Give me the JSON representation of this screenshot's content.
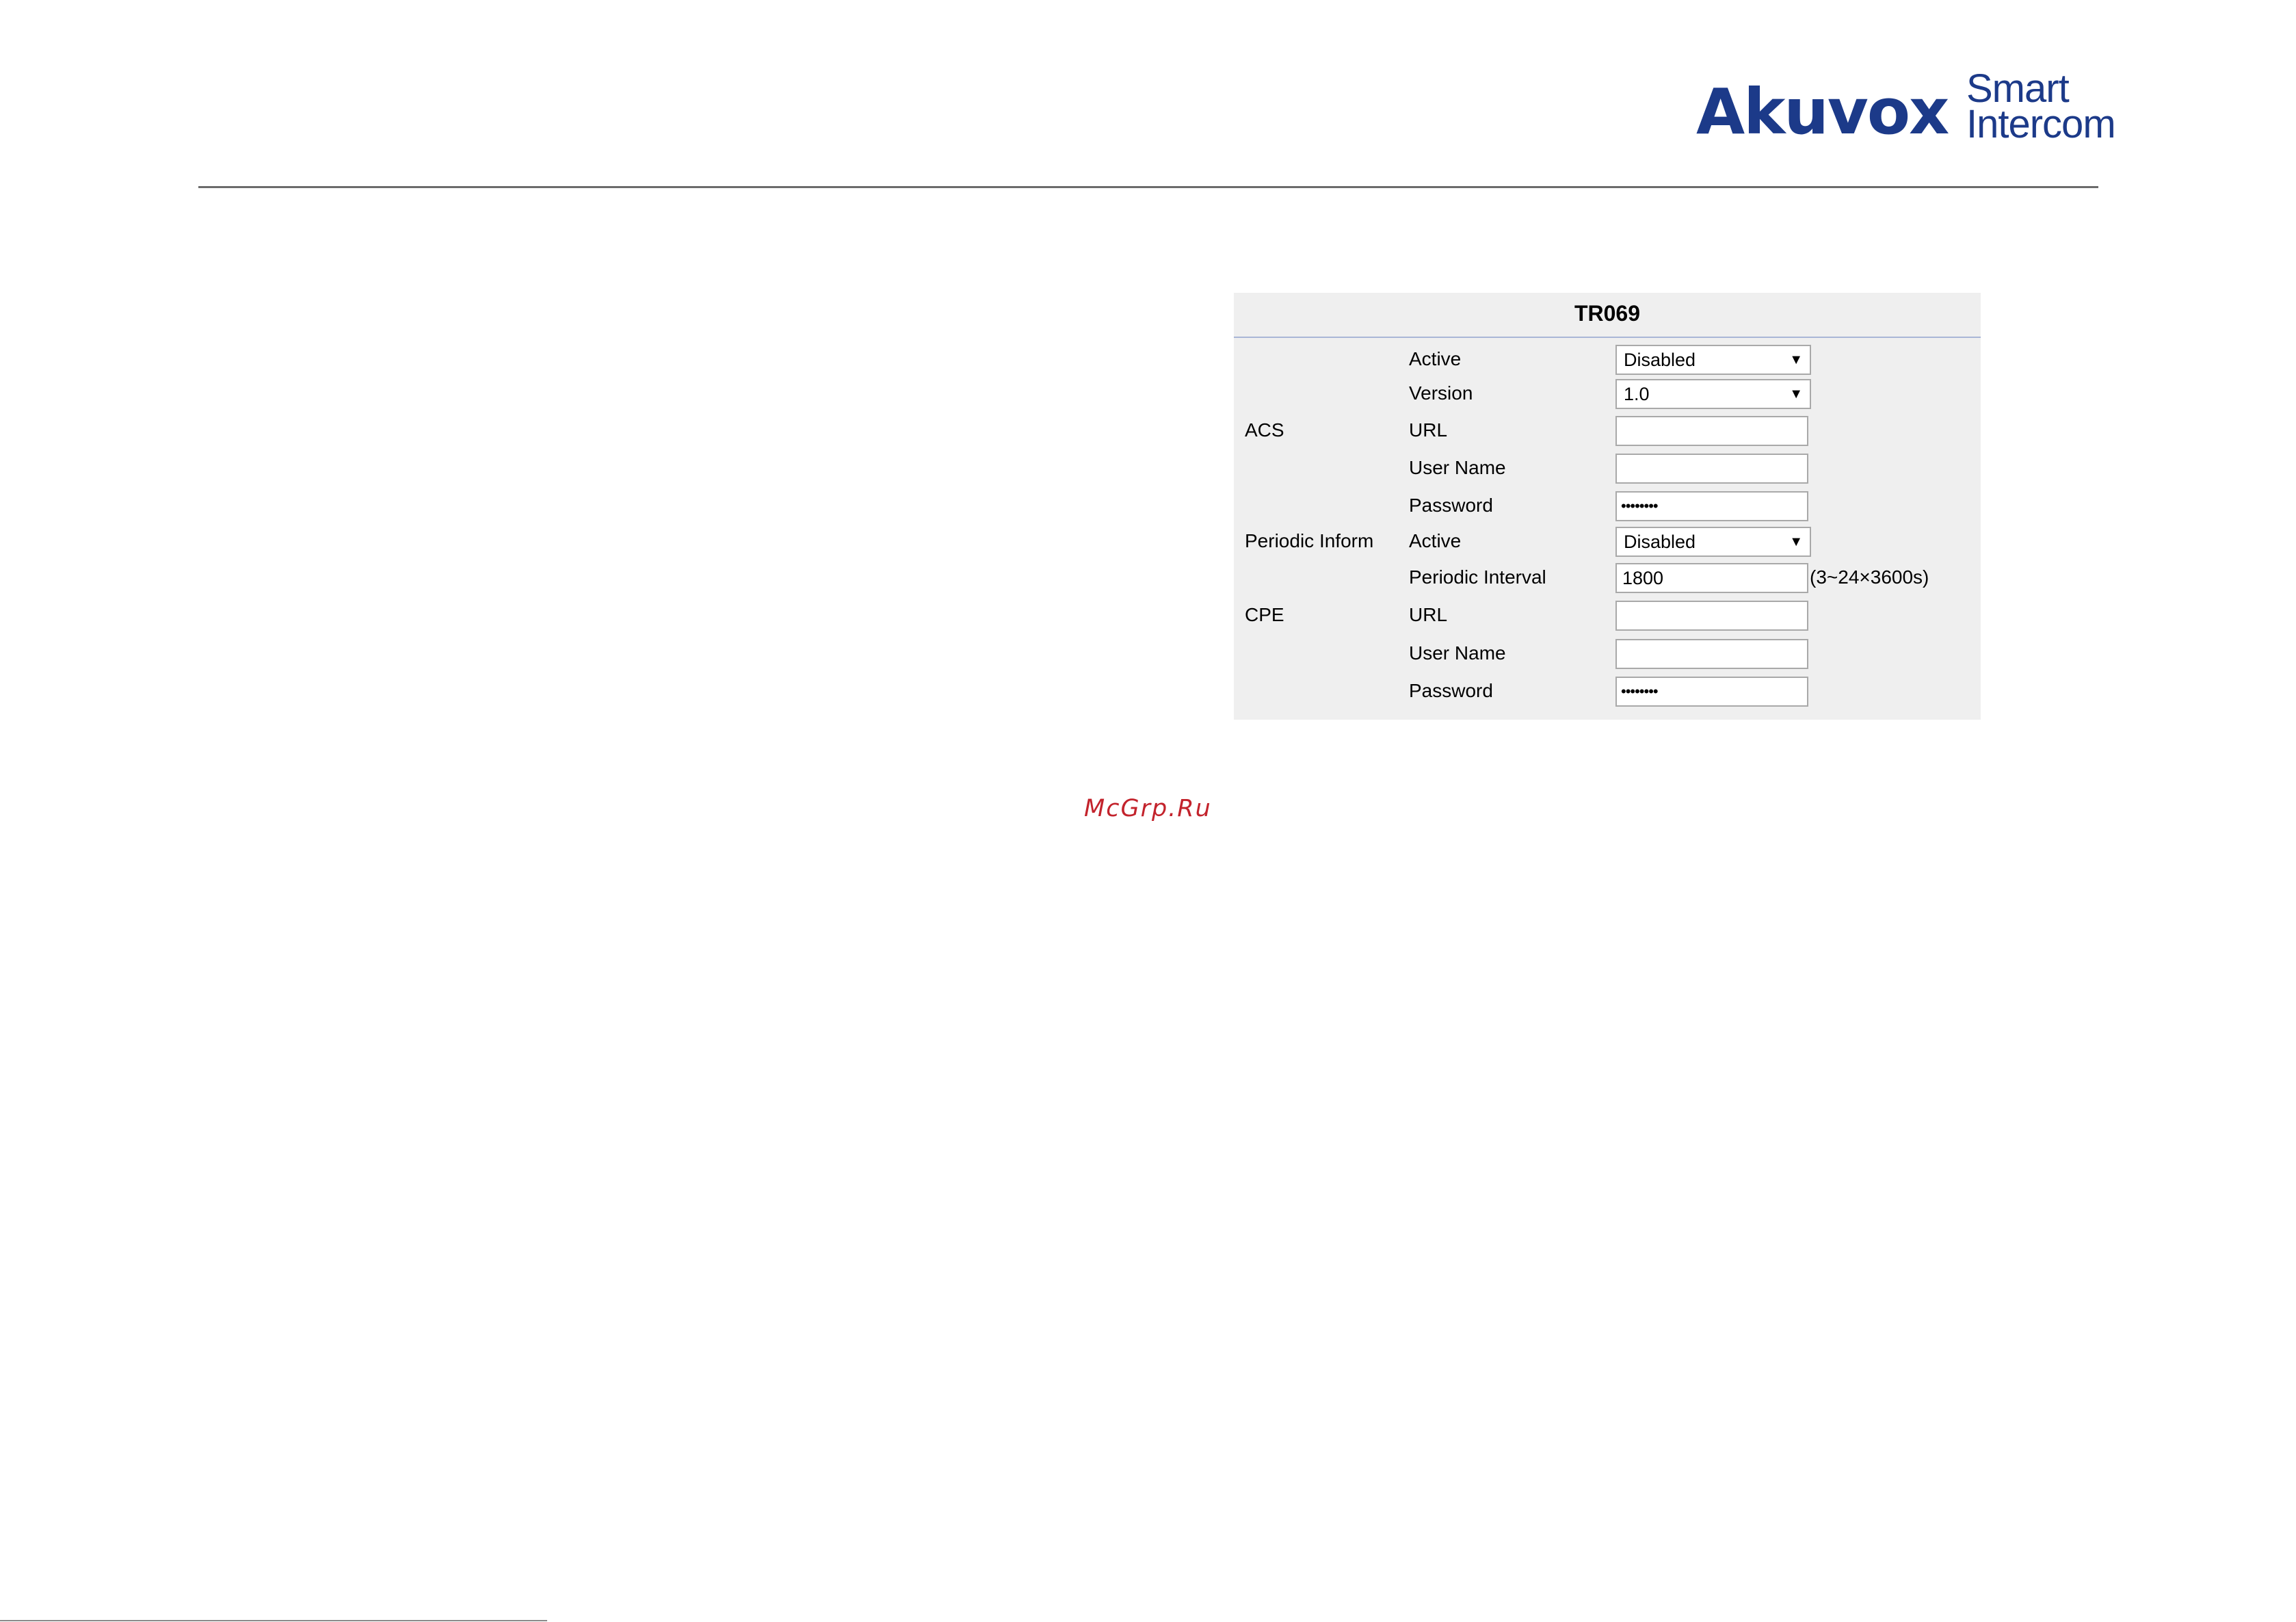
{
  "header": {
    "logo_brand": "Akuvox",
    "logo_tag_line1": "Smart",
    "logo_tag_line2": "Intercom",
    "brand_color": "#1c3a89"
  },
  "panel": {
    "title": "TR069",
    "rows": [
      {
        "group": "",
        "label": "Active",
        "control": "select",
        "value": "Disabled"
      },
      {
        "group": "",
        "label": "Version",
        "control": "select",
        "value": "1.0"
      },
      {
        "group": "ACS",
        "label": "URL",
        "control": "input",
        "value": ""
      },
      {
        "group": "",
        "label": "User Name",
        "control": "input",
        "value": ""
      },
      {
        "group": "",
        "label": "Password",
        "control": "password",
        "value": "••••••••"
      },
      {
        "group": "Periodic Inform",
        "label": "Active",
        "control": "select",
        "value": "Disabled"
      },
      {
        "group": "",
        "label": "Periodic Interval",
        "control": "input",
        "value": "1800",
        "hint": "(3~24×3600s)"
      },
      {
        "group": "CPE",
        "label": "URL",
        "control": "input",
        "value": ""
      },
      {
        "group": "",
        "label": "User Name",
        "control": "input",
        "value": ""
      },
      {
        "group": "",
        "label": "Password",
        "control": "password",
        "value": "••••••••"
      }
    ]
  },
  "watermark": {
    "text": "McGrp.Ru",
    "color": "#c3232c"
  }
}
